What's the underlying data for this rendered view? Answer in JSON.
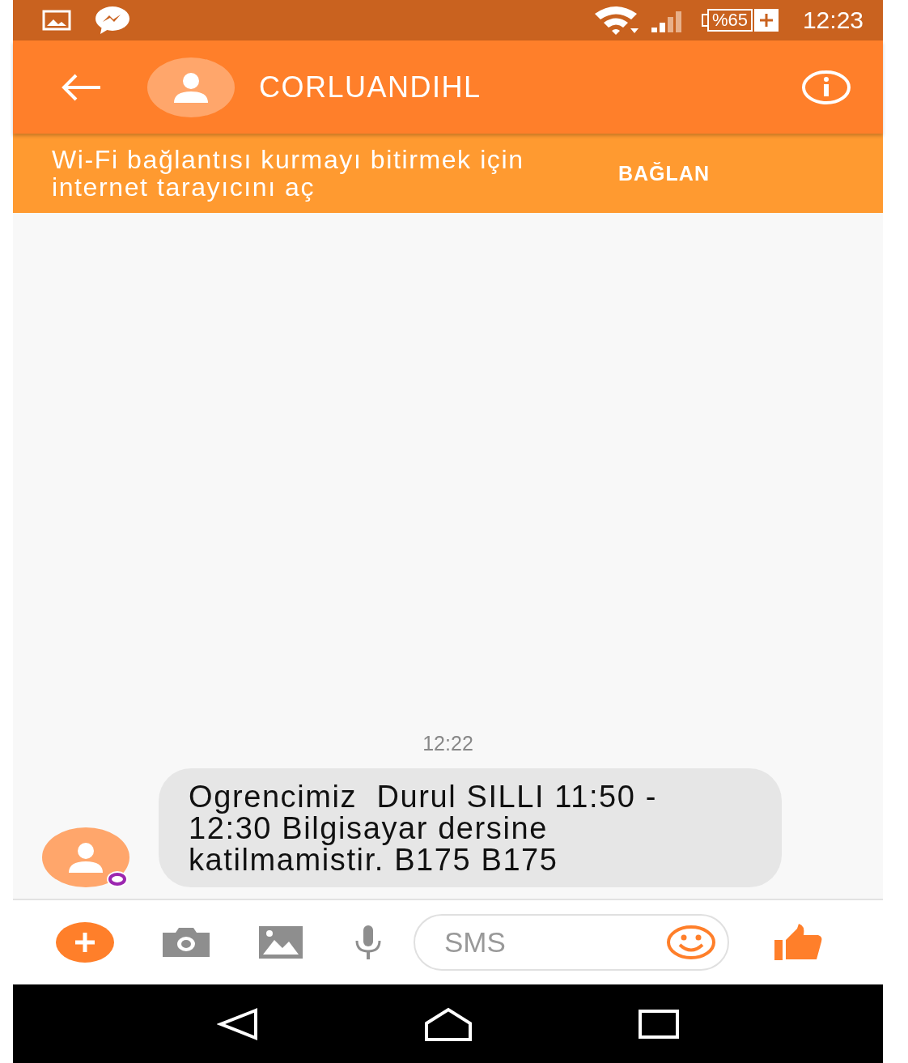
{
  "status_bar": {
    "battery": "%65",
    "time": "12:23"
  },
  "header": {
    "title": "CORLUANDIHL"
  },
  "banner": {
    "message": "Wi-Fi bağlantısı kurmayı bitirmek için internet tarayıcını aç",
    "action": "BAĞLAN"
  },
  "messages": [
    {
      "time": "12:22",
      "text": "Ogrencimiz  Durul SILLI 11:50 - 12:30 Bilgisayar dersine katilmamistir. B175 B175"
    }
  ],
  "composer": {
    "placeholder": "SMS"
  }
}
